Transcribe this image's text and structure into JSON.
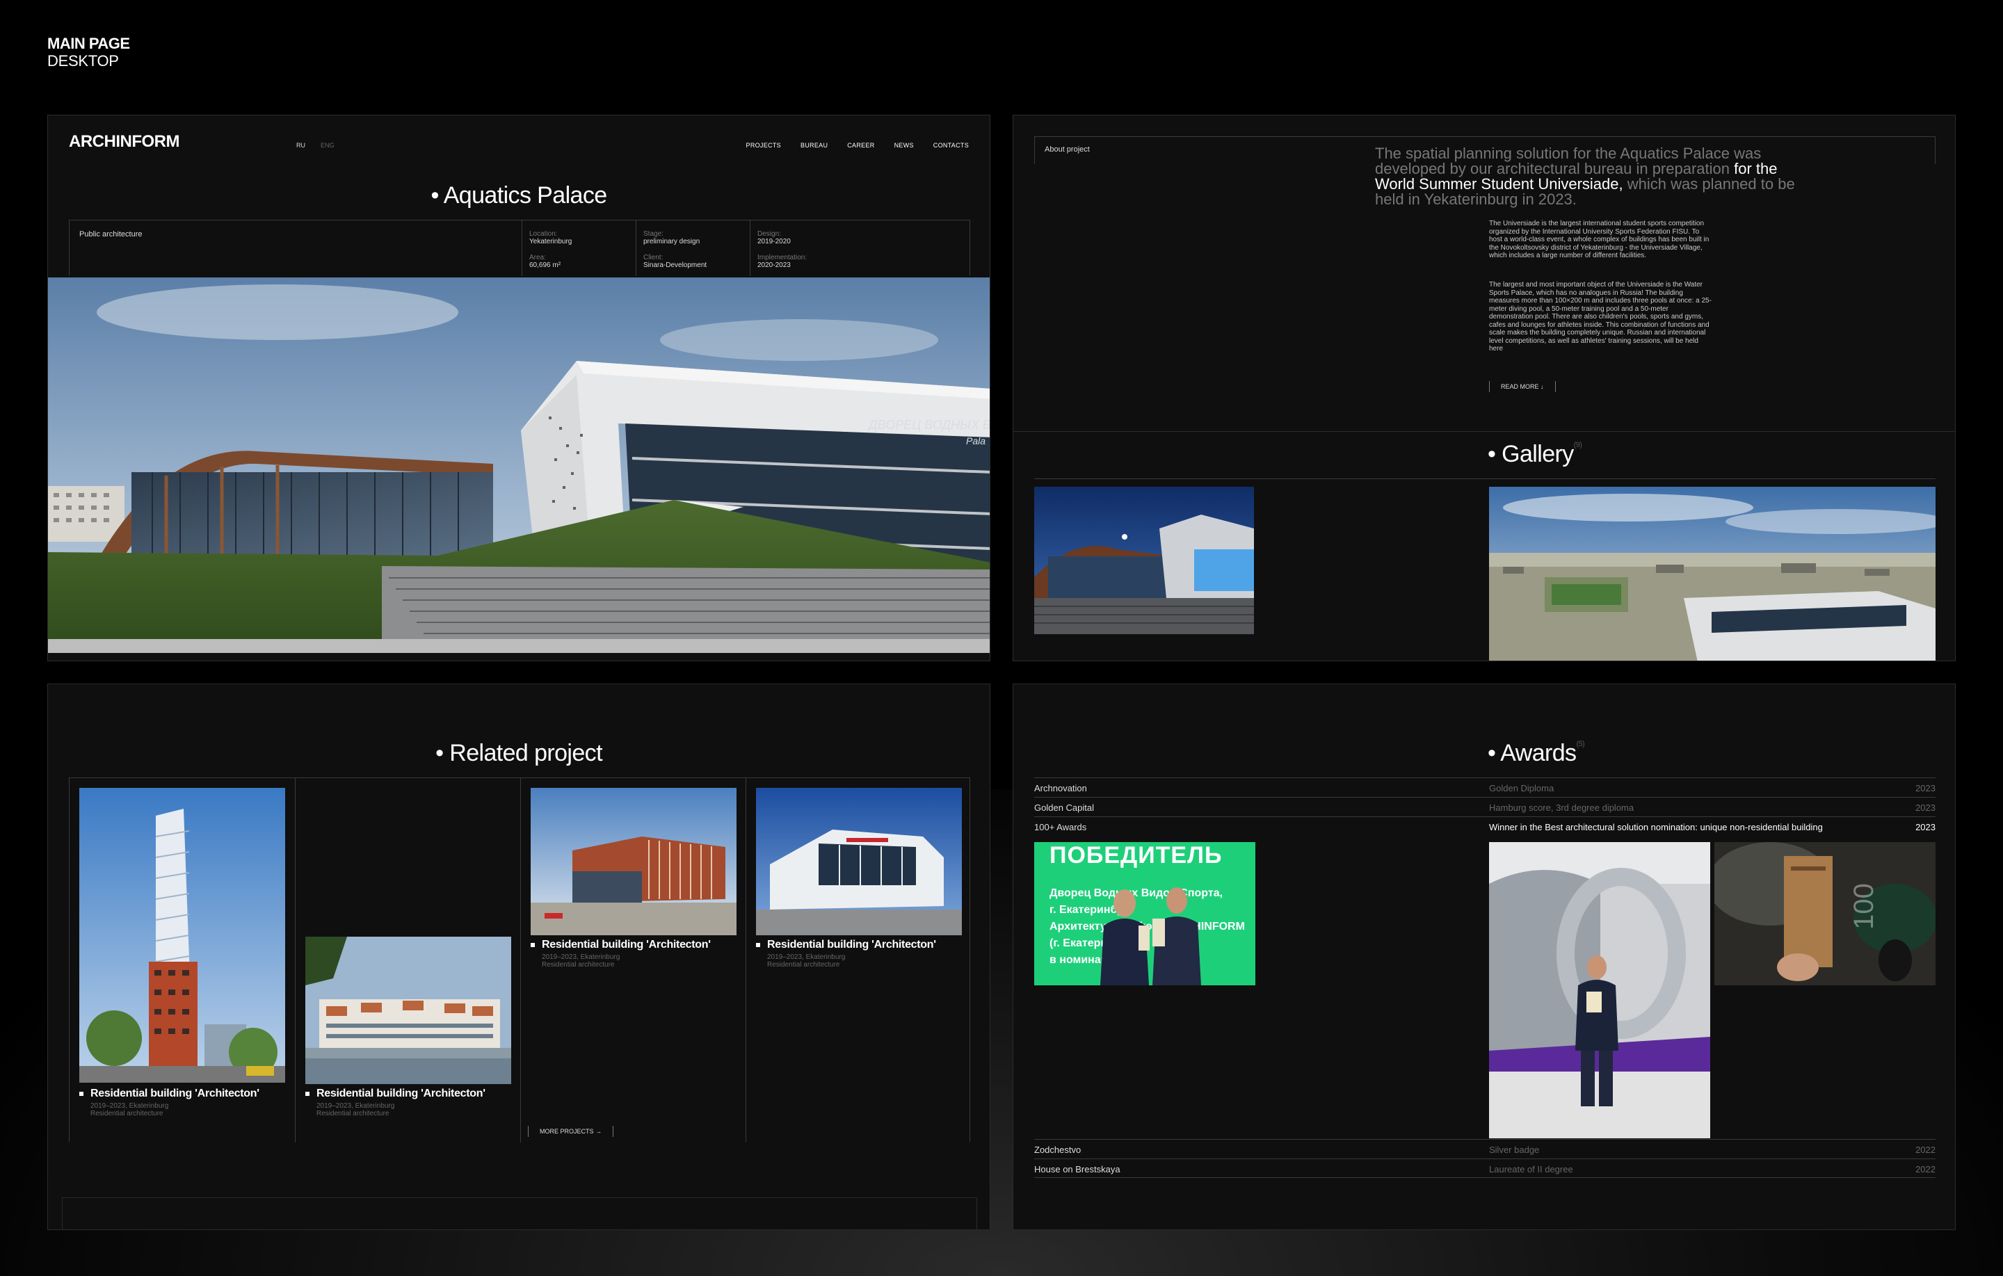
{
  "caption": {
    "line1": "MAIN PAGE",
    "line2": "DESKTOP"
  },
  "header": {
    "logo": "ARCHINFORM",
    "lang_ru": "RU",
    "lang_en": "ENG",
    "nav": [
      "PROJECTS",
      "BUREAU",
      "CAREER",
      "NEWS",
      "CONTACTS"
    ]
  },
  "project": {
    "title": "Aquatics Palace",
    "category": "Public architecture",
    "location_label": "Location:",
    "location": "Yekaterinburg",
    "area_label": "Area:",
    "area": "60,696 m²",
    "stage_label": "Stage:",
    "stage": "preliminary design",
    "client_label": "Client:",
    "client": "Sinara-Development",
    "design_label": "Design:",
    "design": "2019-2020",
    "impl_label": "Implementation:",
    "impl": "2020-2023",
    "facade_text": "ДВОРЕЦ ВОДНЫХ В",
    "facade_text2": "Pala"
  },
  "about": {
    "label": "About project",
    "intro_a": "The spatial planning solution for the Aquatics Palace was developed by our architectural bureau in preparation ",
    "intro_hl": "for the World Summer Student Universiade,",
    "intro_b": " which was planned to be held in Yekaterinburg in 2023.",
    "p1": "The Universiade is the largest international student sports competition organized by the International University Sports Federation FISU. To host a world-class event, a whole complex of buildings has been built in the Novokoltsovsky district of Yekaterinburg - the Universiade Village, which includes a large number of different facilities.",
    "p2": "The largest and most important object of the Universiade is the Water Sports Palace, which has no analogues in Russia! The building measures more than 100×200 m and includes three pools at once: a 25-meter diving pool, a 50-meter training pool and a 50-meter demonstration pool. There are also children's pools, sports and gyms, cafes and lounges for athletes inside. This combination of functions and scale makes the building completely unique. Russian and international level competitions, as well as athletes' training sessions, will be held here",
    "read_more": "READ MORE ↓"
  },
  "gallery": {
    "title": "Gallery",
    "count": "(9)"
  },
  "related": {
    "title": "Related project",
    "cards": [
      {
        "name": "Residential building 'Architecton'",
        "meta1": "2019–2023, Ekaterinburg",
        "meta2": "Residential architecture"
      },
      {
        "name": "Residential building 'Architecton'",
        "meta1": "2019–2023, Ekaterinburg",
        "meta2": "Residential architecture"
      },
      {
        "name": "Residential building 'Architecton'",
        "meta1": "2019–2023, Ekaterinburg",
        "meta2": "Residential architecture"
      },
      {
        "name": "Residential building 'Architecton'",
        "meta1": "2019–2023, Ekaterinburg",
        "meta2": "Residential architecture"
      }
    ],
    "more": "MORE PROJECTS →"
  },
  "awards": {
    "title": "Awards",
    "count": "(5)",
    "rows": [
      {
        "name": "Archnovation",
        "award": "Golden Diploma",
        "year": "2023"
      },
      {
        "name": "Golden Capital",
        "award": "Hamburg score, 3rd degree diploma",
        "year": "2023"
      },
      {
        "name": "100+ Awards",
        "award": "Winner in the Best architectural solution nomination: unique non-residential building",
        "year": "2023"
      },
      {
        "name": "Zodchestvo",
        "award": "Silver badge",
        "year": "2022"
      },
      {
        "name": "House on Brestskaya",
        "award": "Laureate of II degree",
        "year": "2022"
      }
    ],
    "banner_title": "ПОБЕДИТЕЛЬ",
    "banner_l1": "Дворец Водных Видов Спорта,",
    "banner_l2": "г. Екатеринбург",
    "banner_l3": "Архитектурное бюро ARCHINFORM",
    "banner_l4": "(г. Екатеринбург)",
    "banner_l5": "в номинации",
    "sign_100": "100"
  }
}
